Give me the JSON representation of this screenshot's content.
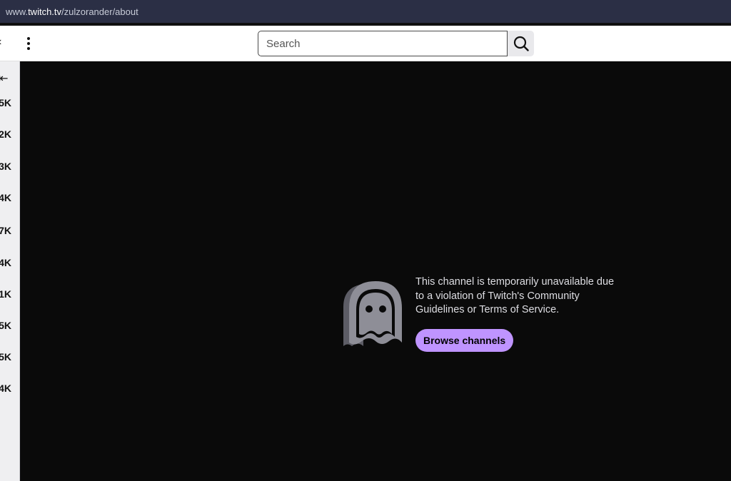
{
  "browser": {
    "url_prefix": "www.",
    "url_host": "twitch.tv",
    "url_path": "/zulzorander/about"
  },
  "nav": {
    "edge_glyph": "‹",
    "more_icon": "more-vertical-icon",
    "search": {
      "placeholder": "Search",
      "value": ""
    },
    "search_icon": "search-icon"
  },
  "sidebar": {
    "collapse_glyph": "⇤",
    "viewer_counts": [
      "5K",
      "2K",
      "3K",
      "4K",
      "7K",
      "4K",
      ".1K",
      "5K",
      "5K",
      "4K"
    ]
  },
  "main": {
    "message": "This channel is temporarily unavailable due to a violation of Twitch's Community Guidelines or Terms of Service.",
    "browse_label": "Browse channels",
    "ghost_icon": "ghost-icon"
  },
  "colors": {
    "accent": "#bf94ff",
    "urlbar_bg": "#2b2f45",
    "main_bg": "#0a0a0a"
  }
}
